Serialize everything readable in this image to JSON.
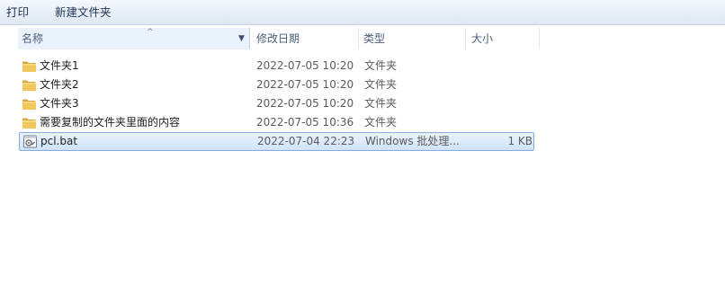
{
  "toolbar": {
    "print_label": "打印",
    "new_folder_label": "新建文件夹"
  },
  "columns": {
    "name": "名称",
    "date": "修改日期",
    "type": "类型",
    "size": "大小"
  },
  "files": [
    {
      "name": "文件夹1",
      "date": "2022-07-05 10:20",
      "type": "文件夹",
      "size": "",
      "icon": "folder-icon"
    },
    {
      "name": "文件夹2",
      "date": "2022-07-05 10:20",
      "type": "文件夹",
      "size": "",
      "icon": "folder-icon"
    },
    {
      "name": "文件夹3",
      "date": "2022-07-05 10:20",
      "type": "文件夹",
      "size": "",
      "icon": "folder-icon"
    },
    {
      "name": "需要复制的文件夹里面的内容",
      "date": "2022-07-05 10:36",
      "type": "文件夹",
      "size": "",
      "icon": "folder-icon"
    },
    {
      "name": "pcl.bat",
      "date": "2022-07-04 22:23",
      "type": "Windows 批处理...",
      "size": "1 KB",
      "icon": "batch-file-icon",
      "selected": true
    }
  ],
  "colors": {
    "folder": "#e8b84a",
    "selection_border": "#84acdd",
    "toolbar_text": "#1e3250"
  }
}
